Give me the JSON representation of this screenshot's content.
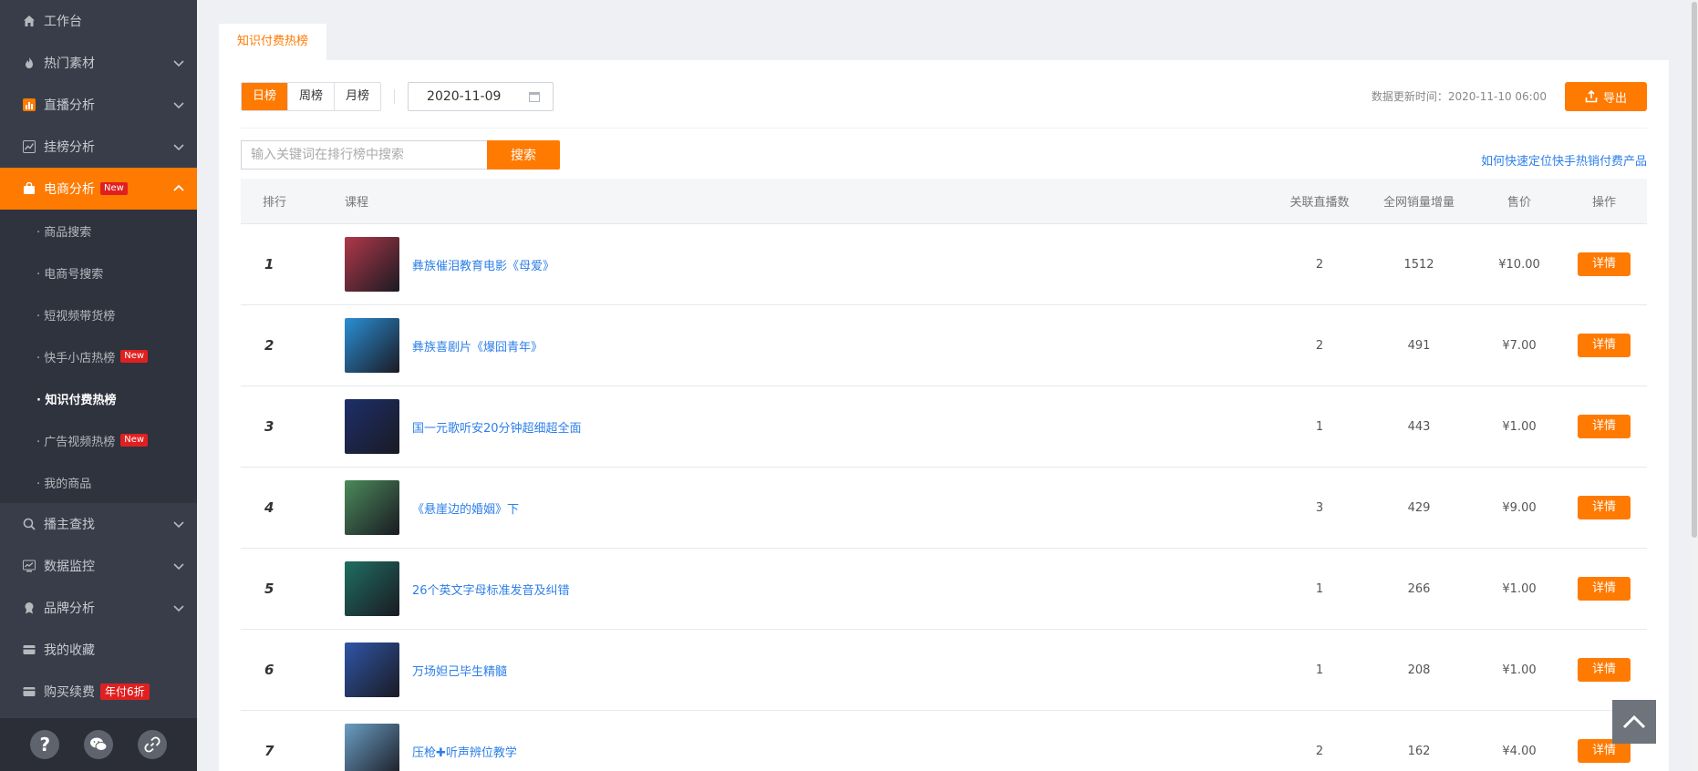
{
  "sidebar": {
    "items": [
      {
        "label": "工作台",
        "icon": "home-icon"
      },
      {
        "label": "热门素材",
        "icon": "fire-icon"
      },
      {
        "label": "直播分析",
        "icon": "bar-chart-icon"
      },
      {
        "label": "挂榜分析",
        "icon": "line-chart-icon"
      },
      {
        "label": "电商分析",
        "icon": "shopping-bag-icon",
        "badge": "New"
      }
    ],
    "ecommerce_sub": [
      {
        "label": "· 商品搜索"
      },
      {
        "label": "· 电商号搜索"
      },
      {
        "label": "· 短视频带货榜"
      },
      {
        "label": "· 快手小店热榜",
        "badge": "New"
      },
      {
        "label": "· 知识付费热榜"
      },
      {
        "label": "· 广告视频热榜",
        "badge": "New"
      },
      {
        "label": "· 我的商品"
      }
    ],
    "items_after": [
      {
        "label": "播主查找",
        "icon": "search-icon"
      },
      {
        "label": "数据监控",
        "icon": "monitor-icon"
      },
      {
        "label": "品牌分析",
        "icon": "brand-icon"
      },
      {
        "label": "我的收藏",
        "icon": "favorite-icon"
      },
      {
        "label": "购买续费",
        "icon": "card-icon",
        "badge": "年付6折"
      }
    ],
    "footer": {
      "help": "?",
      "wechat": "wechat-icon",
      "link": "link-icon"
    }
  },
  "tab": {
    "label": "知识付费热榜"
  },
  "toolbar": {
    "periods": [
      "日榜",
      "周榜",
      "月榜"
    ],
    "active_period": "日榜",
    "date": "2020-11-09",
    "update_time": "数据更新时间：2020-11-10 06:00",
    "export_label": "导出"
  },
  "search": {
    "placeholder": "输入关键词在排行榜中搜索",
    "button_label": "搜索",
    "help_link": "如何快速定位快手热销付费产品"
  },
  "table": {
    "headers": {
      "rank": "排行",
      "course": "课程",
      "live": "关联直播数",
      "sales": "全网销量增量",
      "price": "售价",
      "op": "操作"
    },
    "rows": [
      {
        "rank": "1",
        "title": "彝族催泪教育电影《母爱》",
        "live": "2",
        "sales": "1512",
        "price": "¥10.00",
        "op": "详情",
        "thumb_color": "#b0384a"
      },
      {
        "rank": "2",
        "title": "彝族喜剧片《爆囧青年》",
        "live": "2",
        "sales": "491",
        "price": "¥7.00",
        "op": "详情",
        "thumb_color": "#2a8fd6"
      },
      {
        "rank": "3",
        "title": "国一元歌听安20分钟超细超全面",
        "live": "1",
        "sales": "443",
        "price": "¥1.00",
        "op": "详情",
        "thumb_color": "#1d2f6b"
      },
      {
        "rank": "4",
        "title": "《悬崖边的婚姻》下",
        "live": "3",
        "sales": "429",
        "price": "¥9.00",
        "op": "详情",
        "thumb_color": "#4b8a5a"
      },
      {
        "rank": "5",
        "title": "26个英文字母标准发音及纠错",
        "live": "1",
        "sales": "266",
        "price": "¥1.00",
        "op": "详情",
        "thumb_color": "#1f6e62"
      },
      {
        "rank": "6",
        "title": "万场妲己毕生精髓",
        "live": "1",
        "sales": "208",
        "price": "¥1.00",
        "op": "详情",
        "thumb_color": "#2f56a8"
      },
      {
        "rank": "7",
        "title": "压枪✚听声辨位教学",
        "live": "2",
        "sales": "162",
        "price": "¥4.00",
        "op": "详情",
        "thumb_color": "#6a9ec4"
      }
    ]
  },
  "colors": {
    "accent": "#ff7a00",
    "sidebar_bg": "#393d49",
    "link": "#2d7fe8"
  }
}
